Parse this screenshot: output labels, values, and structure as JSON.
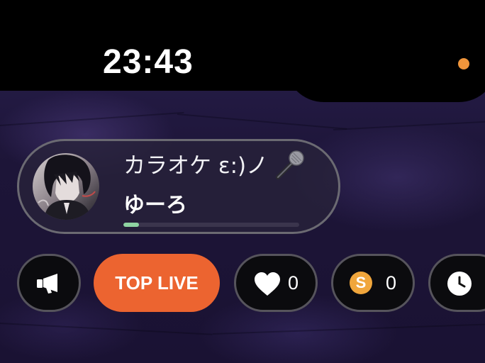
{
  "status_bar": {
    "time": "23:43",
    "indicator_color": "#f0953b"
  },
  "live_card": {
    "title": "カラオケ  ε:)ノ",
    "title_icon": "microphone-icon",
    "streamer_name": "ゆーろ",
    "progress_fraction": 0.09,
    "progress_color": "#8fd4a2"
  },
  "action_bar": {
    "megaphone_icon": "megaphone-icon",
    "top_live_label": "TOP LIVE",
    "top_live_color": "#ec6430",
    "likes": {
      "icon": "heart-icon",
      "count": "0"
    },
    "coins": {
      "icon": "coin-icon",
      "symbol": "S",
      "count": "0",
      "color": "#f0a63c"
    },
    "timer": {
      "icon": "clock-icon"
    }
  }
}
